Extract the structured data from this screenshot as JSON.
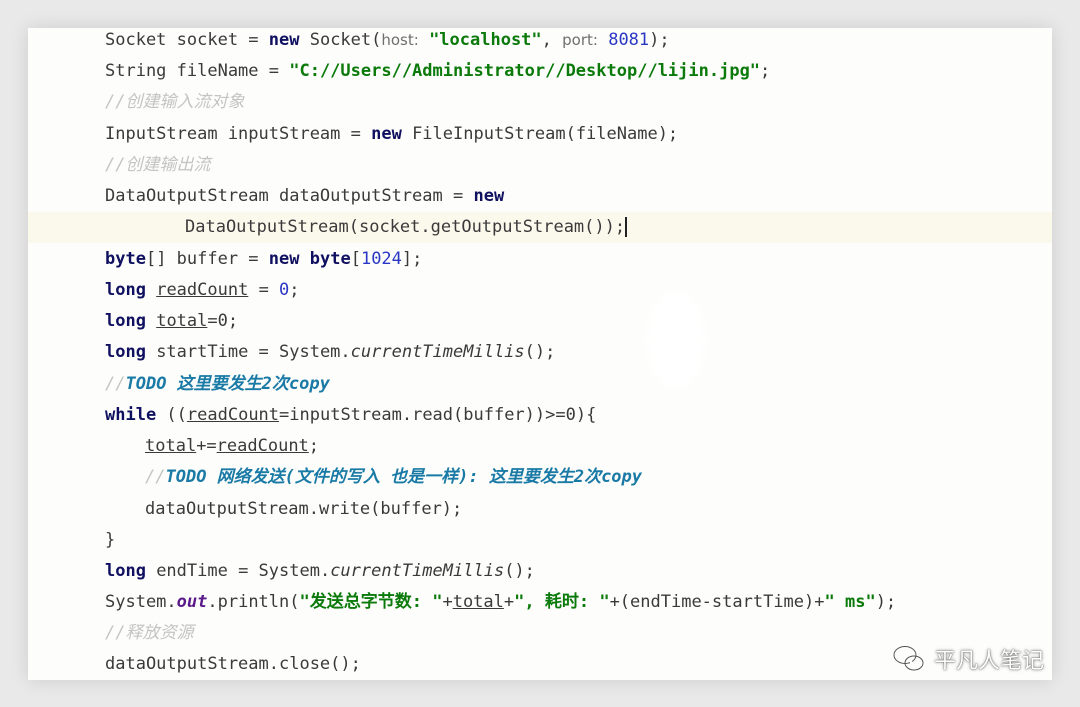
{
  "code": {
    "l01": {
      "kw": "Socket socket = ",
      "new": "new",
      "cls": " Socket(",
      "hint_host": "host:",
      "sp": " ",
      "str": "\"localhost\"",
      "comma": ", ",
      "hint_port": "port:",
      "sp2": " ",
      "num": "8081",
      "end": ");"
    },
    "l02": {
      "pre": "String fileName = ",
      "str": "\"C://Users//Administrator//Desktop//lijin.jpg\"",
      "end": ";"
    },
    "l03": {
      "cmt": "//创建输入流对象"
    },
    "l04": {
      "pre": "InputStream inputStream = ",
      "new": "new",
      "post": " FileInputStream(fileName);"
    },
    "l05": {
      "cmt": "//创建输出流"
    },
    "l06": {
      "pre": "DataOutputStream dataOutputStream = ",
      "new": "new"
    },
    "l07": {
      "text": "DataOutputStream(socket.getOutputStream());"
    },
    "l08": {
      "k1": "byte",
      "a": "[] buffer = ",
      "k2": "new",
      "sp": " ",
      "k3": "byte",
      "b": "[",
      "num": "1024",
      "c": "];"
    },
    "l09": {
      "k": "long",
      "sp": " ",
      "var": "readCount",
      "mid": " = ",
      "num": "0",
      "end": ";"
    },
    "l10": {
      "k": "long",
      "sp": " ",
      "var": "total",
      "mid": "=0;"
    },
    "l11": {
      "k": "long",
      "pre": " startTime = System.",
      "m": "currentTimeMillis",
      "end": "();"
    },
    "l12": {
      "slash": "//",
      "todo": "TODO 这里要发生2次copy"
    },
    "l13": {
      "k": "while",
      "a": " ((",
      "var": "readCount",
      "b": "=inputStream.read(buffer))>=0){"
    },
    "l14": {
      "var": "total",
      "mid": "+=",
      "var2": "readCount",
      "end": ";"
    },
    "l15": {
      "slash": "//",
      "todo": "TODO 网络发送(文件的写入 也是一样): 这里要发生2次copy"
    },
    "l16": {
      "text": "dataOutputStream.write(buffer);"
    },
    "l17": {
      "text": "}"
    },
    "l18": {
      "k": "long",
      "pre": " endTime = System.",
      "m": "currentTimeMillis",
      "end": "();"
    },
    "l19": {
      "a": "System.",
      "f": "out",
      "b": ".println(",
      "s1": "\"发送总字节数: \"",
      "c": "+",
      "var": "total",
      "d": "+",
      "s2": "\", 耗时: \"",
      "e": "+(endTime-startTime)+",
      "s3": "\" ms\"",
      "end": ");"
    },
    "l20": {
      "cmt": "//释放资源"
    },
    "l21": {
      "text": "dataOutputStream.close();"
    }
  },
  "watermark": {
    "text": "平凡人笔记",
    "icon": "wechat-icon"
  },
  "colors": {
    "keyword": "#101060",
    "string": "#0b7a0b",
    "number": "#2a37c4",
    "todo": "#1a7aa6",
    "comment": "#c4c4c4",
    "highlight_line": "#fbf8ec"
  }
}
